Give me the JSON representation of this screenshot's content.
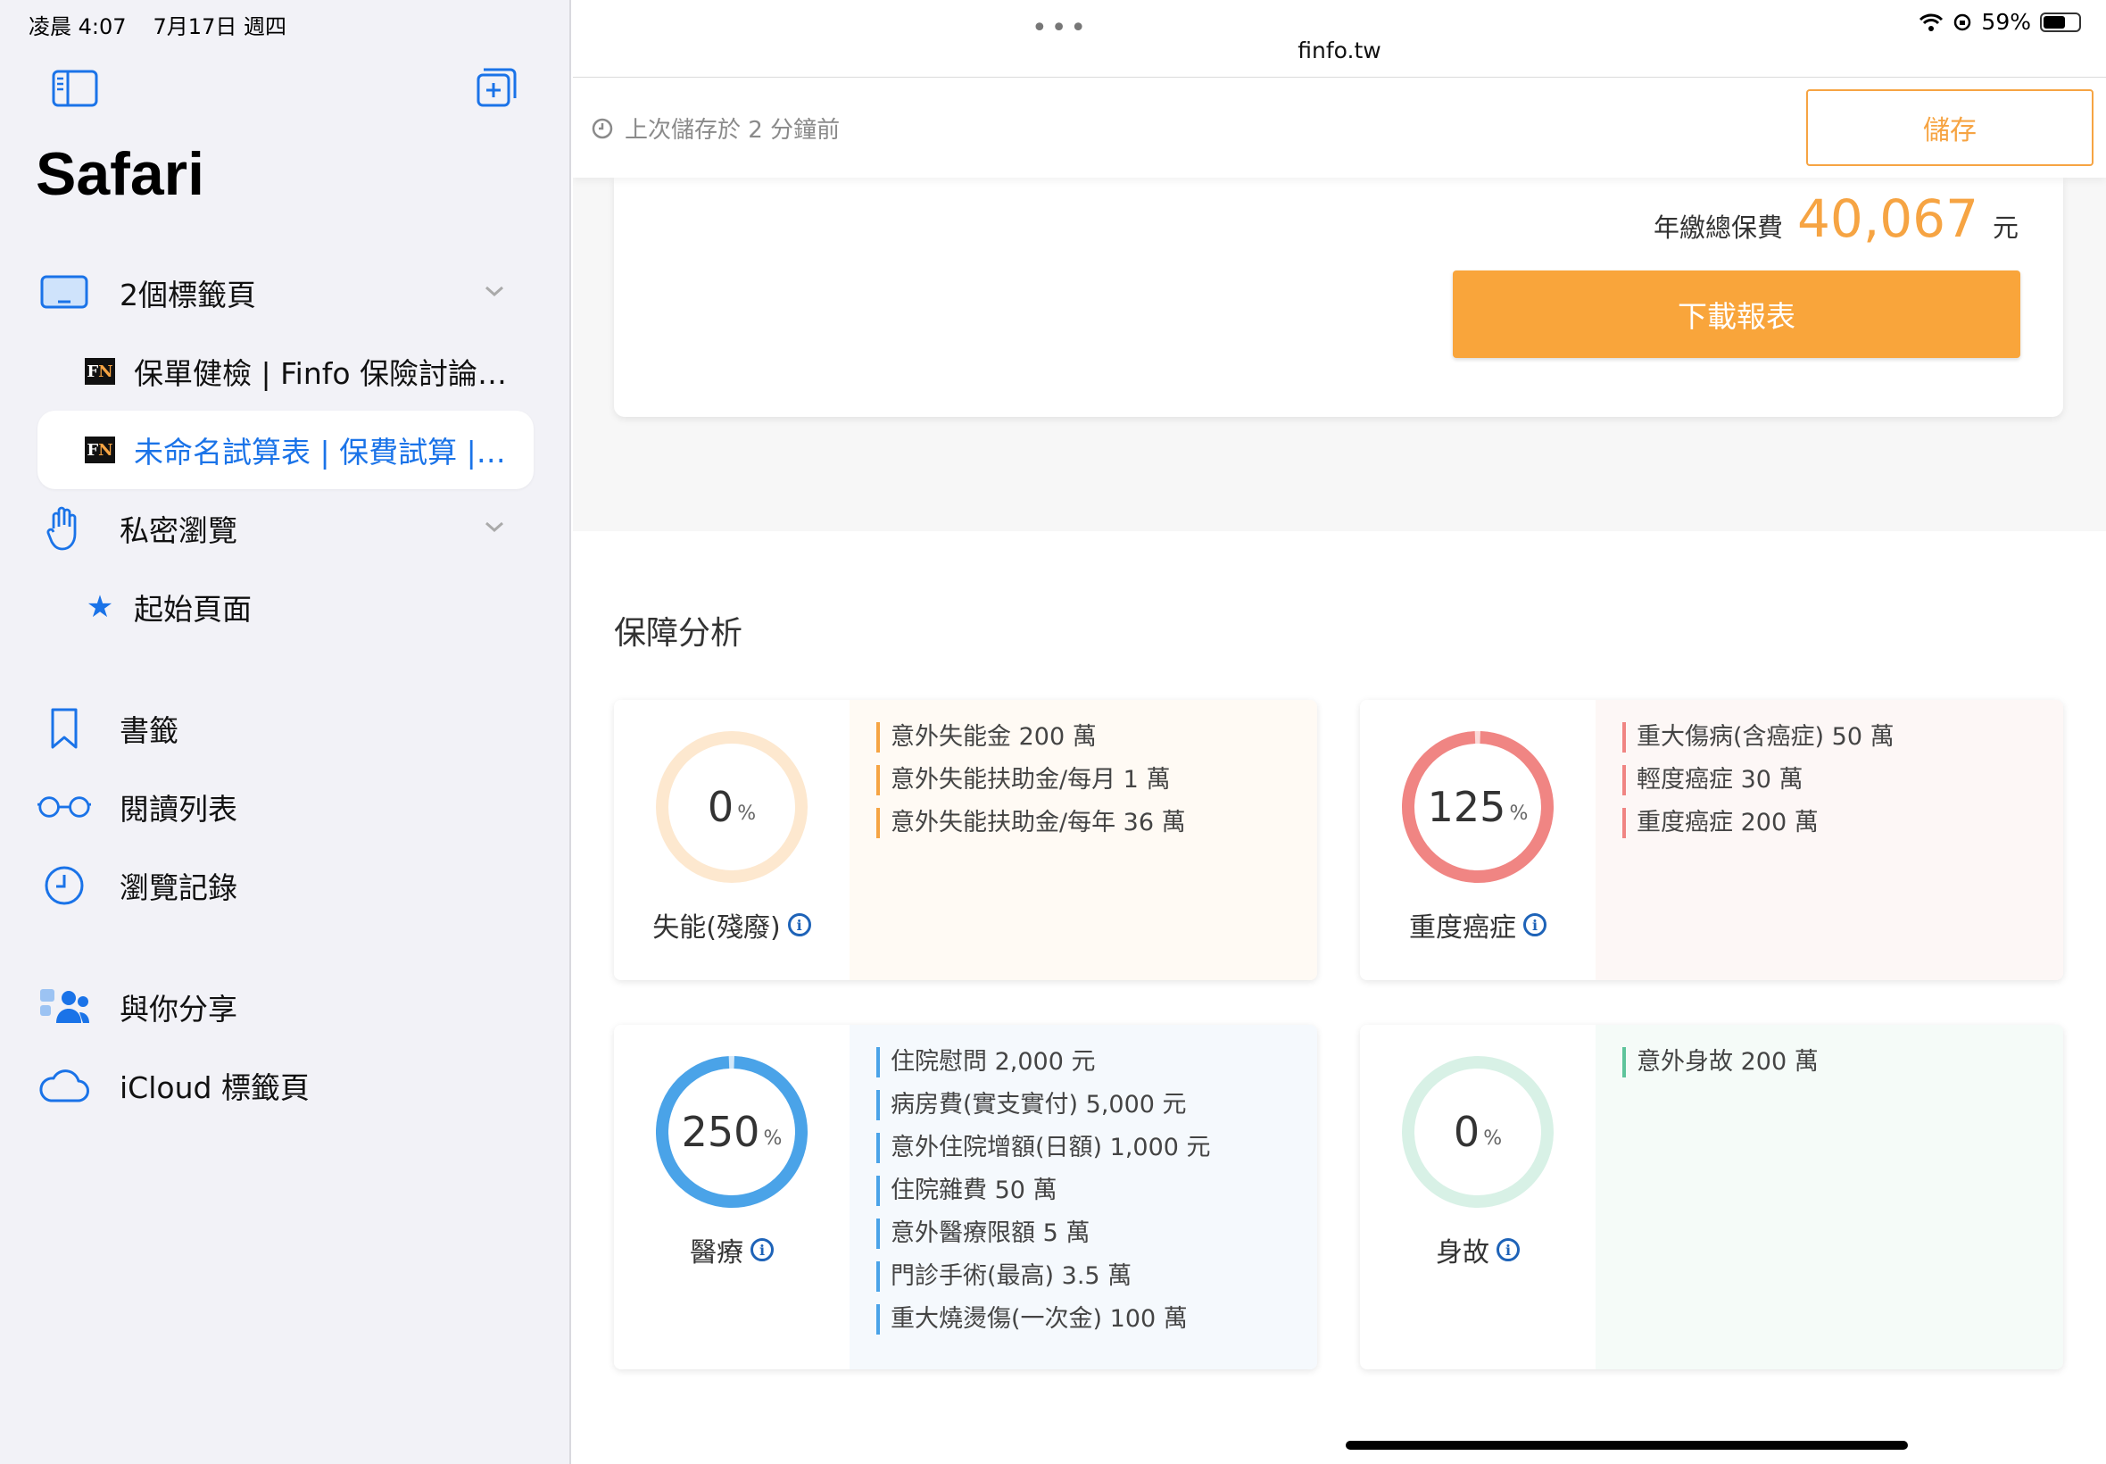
{
  "status": {
    "time": "凌晨 4:07",
    "date": "7月17日 週四",
    "battery": "59%"
  },
  "sidebar": {
    "title": "Safari",
    "tab_group": "2個標籤頁",
    "tabs": [
      "保單健檢 | Finfo 保險討論…",
      "未命名試算表 | 保費試算 |…"
    ],
    "private": "私密瀏覽",
    "start_page": "起始頁面",
    "bookmarks": "書籤",
    "reading_list": "閱讀列表",
    "history": "瀏覽記錄",
    "shared": "與你分享",
    "icloud": "iCloud 標籤頁"
  },
  "browser": {
    "url": "finfo.tw"
  },
  "savebar": {
    "saved_text": "上次儲存於 2 分鐘前",
    "save_label": "儲存"
  },
  "summary": {
    "label": "年繳總保費",
    "total": "40,067",
    "unit": "元",
    "download_label": "下載報表"
  },
  "section_title": "保障分析",
  "cards": [
    {
      "label": "失能(殘廢)",
      "percent": "0",
      "percent_value": 0,
      "unit": "%",
      "color": "#f6a443",
      "ring_bg": "#fde8cf",
      "panel_bg": "#fffaf4",
      "items": [
        "意外失能金 200 萬",
        "意外失能扶助金/每月 1 萬",
        "意外失能扶助金/每年 36 萬"
      ]
    },
    {
      "label": "重度癌症",
      "percent": "125",
      "percent_value": 125,
      "unit": "%",
      "color": "#f08583",
      "ring_bg": "#fbd9d8",
      "panel_bg": "#fdf7f6",
      "items": [
        "重大傷病(含癌症) 50 萬",
        "輕度癌症 30 萬",
        "重度癌症 200 萬"
      ]
    },
    {
      "label": "醫療",
      "percent": "250",
      "percent_value": 250,
      "unit": "%",
      "color": "#4aa3e8",
      "ring_bg": "#d3e8f9",
      "panel_bg": "#f5f9fd",
      "items": [
        "住院慰問 2,000 元",
        "病房費(實支實付) 5,000 元",
        "意外住院增額(日額) 1,000 元",
        "住院雜費 50 萬",
        "意外醫療限額 5 萬",
        "門診手術(最高) 3.5 萬",
        "重大燒燙傷(一次金) 100 萬"
      ]
    },
    {
      "label": "身故",
      "percent": "0",
      "percent_value": 0,
      "unit": "%",
      "color": "#5ec49b",
      "ring_bg": "#d8f1e6",
      "panel_bg": "#f5fbf8",
      "items": [
        "意外身故 200 萬"
      ]
    }
  ]
}
